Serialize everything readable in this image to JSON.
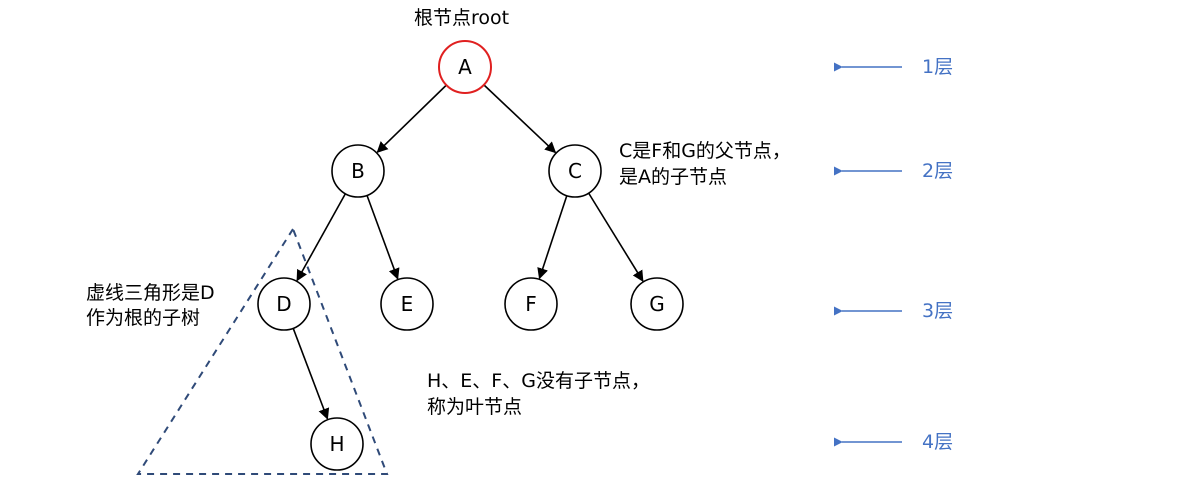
{
  "root_label": "根节点root",
  "nodes": [
    {
      "id": "A",
      "label": "A",
      "is_root": true
    },
    {
      "id": "B",
      "label": "B",
      "is_root": false
    },
    {
      "id": "C",
      "label": "C",
      "is_root": false
    },
    {
      "id": "D",
      "label": "D",
      "is_root": false
    },
    {
      "id": "E",
      "label": "E",
      "is_root": false
    },
    {
      "id": "F",
      "label": "F",
      "is_root": false
    },
    {
      "id": "G",
      "label": "G",
      "is_root": false
    },
    {
      "id": "H",
      "label": "H",
      "is_root": false
    }
  ],
  "edges": [
    {
      "from": "A",
      "to": "B"
    },
    {
      "from": "A",
      "to": "C"
    },
    {
      "from": "B",
      "to": "D"
    },
    {
      "from": "B",
      "to": "E"
    },
    {
      "from": "C",
      "to": "F"
    },
    {
      "from": "C",
      "to": "G"
    },
    {
      "from": "D",
      "to": "H"
    }
  ],
  "annotations": {
    "parent_child": [
      "C是F和G的父节点，",
      "是A的子节点"
    ],
    "subtree": [
      "虚线三角形是D",
      "作为根的子树"
    ],
    "leaves": [
      "H、E、F、G没有子节点，",
      "称为叶节点"
    ]
  },
  "levels": [
    "1层",
    "2层",
    "3层",
    "4层"
  ],
  "colors": {
    "root_stroke": "#e02020",
    "node_stroke": "#000000",
    "subtree_dash": "#2f4a78",
    "level_color": "#4472c4"
  }
}
